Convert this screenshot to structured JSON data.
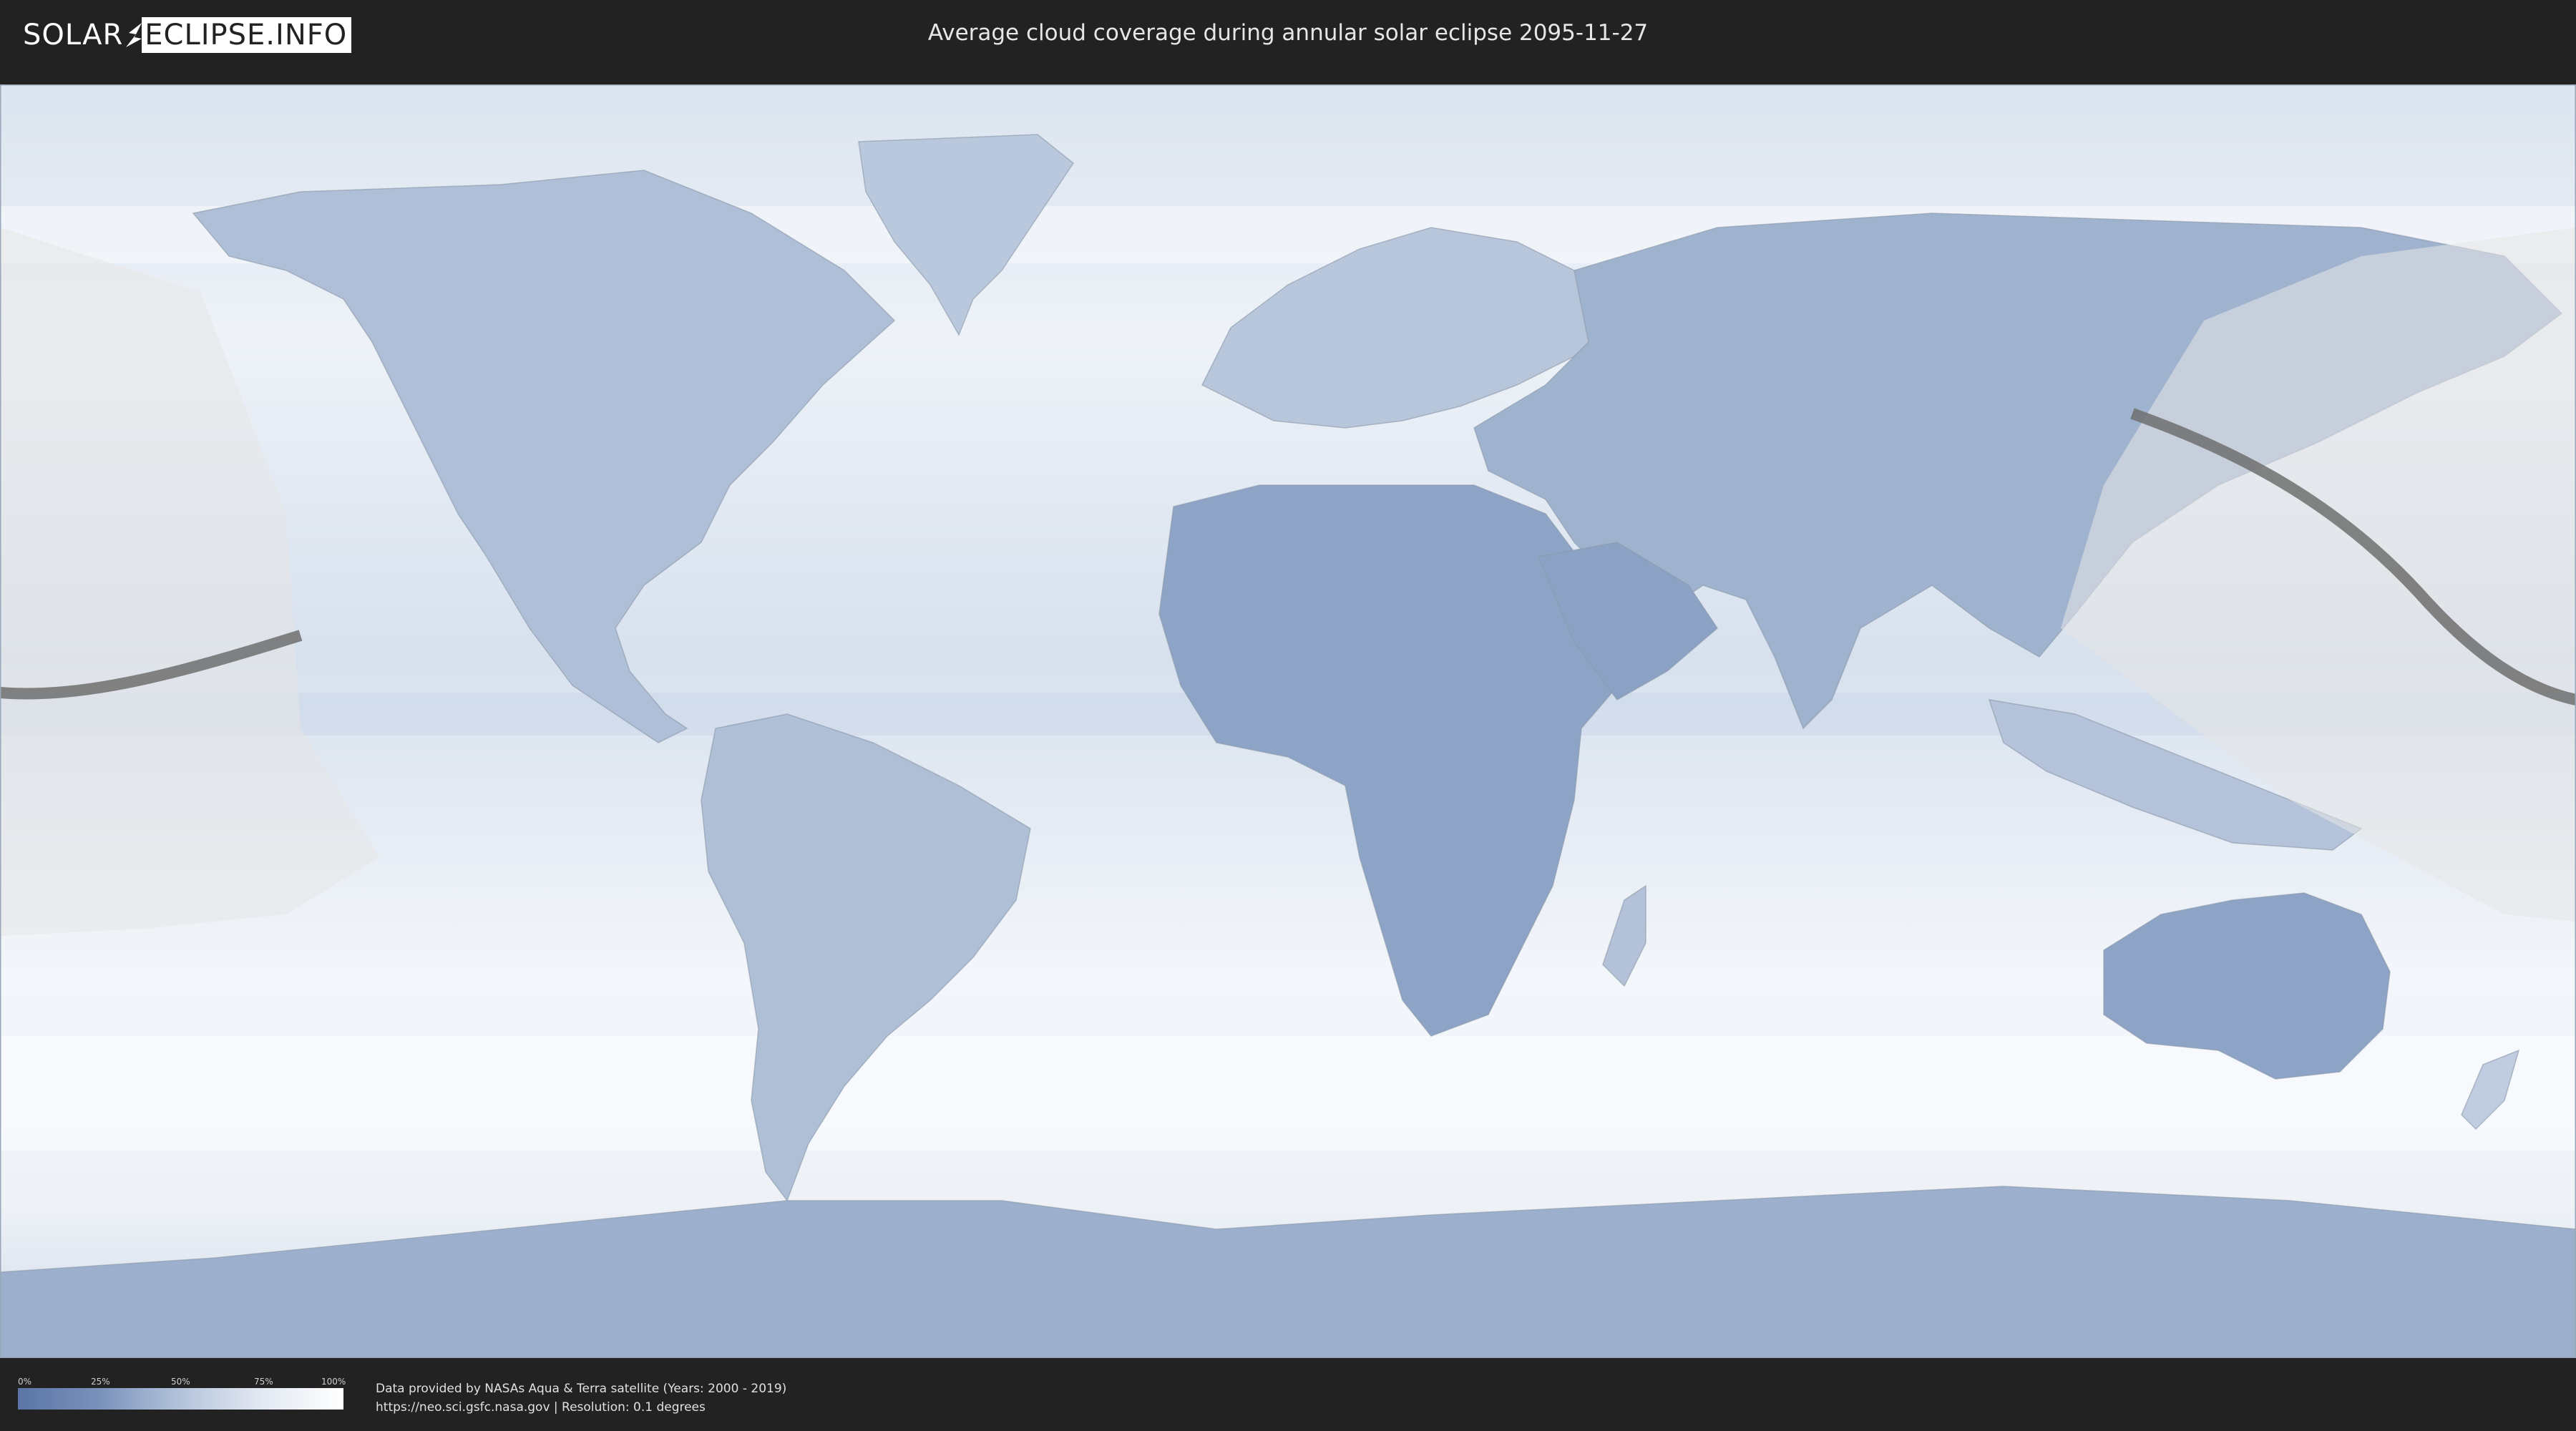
{
  "header": {
    "logo_left": "SOLAR",
    "logo_right": "ECLIPSE.INFO",
    "title": "Average cloud coverage during annular solar eclipse 2095-11-27"
  },
  "map": {
    "eclipse_path_color": "#6e6e6e",
    "visibility_shade_color": "#e6e6e6",
    "cloud_low_color": "#5a75a6",
    "cloud_high_color": "#ffffff"
  },
  "legend": {
    "ticks": [
      "0%",
      "25%",
      "50%",
      "75%",
      "100%"
    ]
  },
  "credits": {
    "line1": "Data provided by NASAs Aqua & Terra satellite (Years: 2000 - 2019)",
    "line2": "https://neo.sci.gsfc.nasa.gov | Resolution: 0.1 degrees"
  }
}
